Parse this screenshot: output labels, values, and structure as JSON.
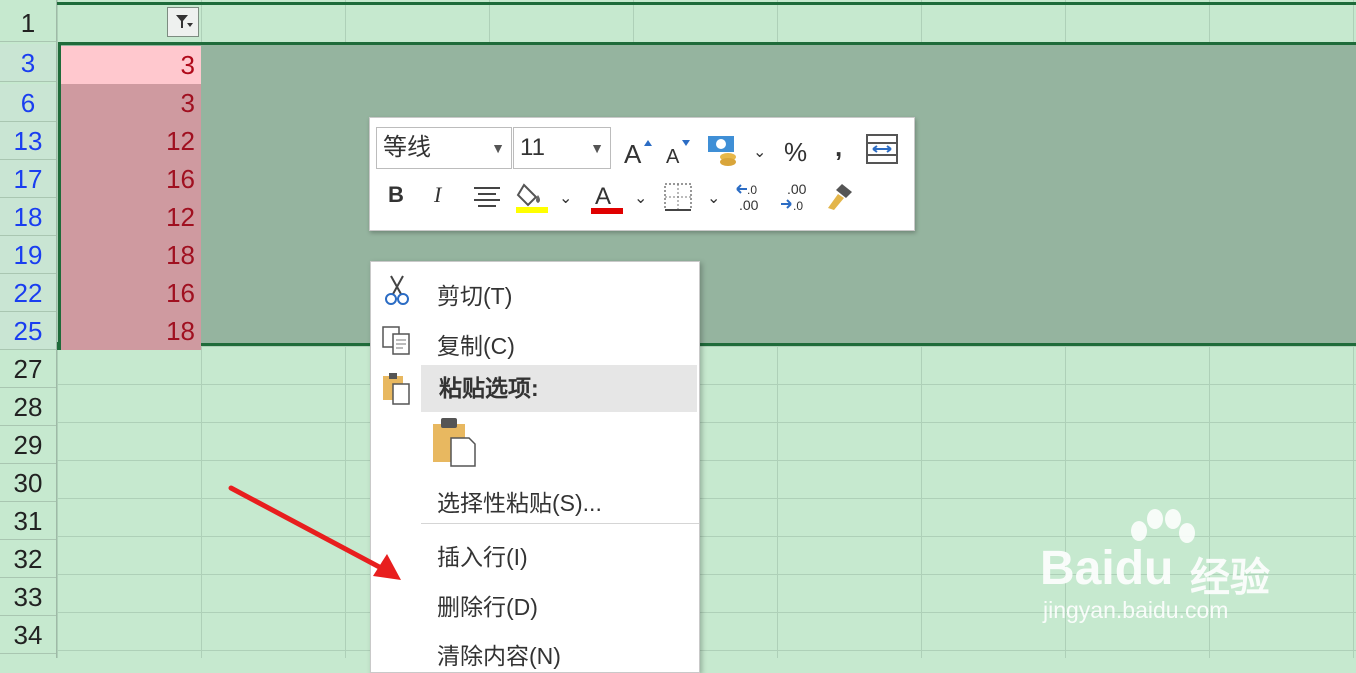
{
  "row_numbers": [
    "1",
    "3",
    "6",
    "13",
    "17",
    "18",
    "19",
    "22",
    "25",
    "27",
    "28",
    "29",
    "30",
    "31",
    "32",
    "33",
    "34"
  ],
  "selected_row_numbers": [
    "3",
    "6",
    "13",
    "17",
    "18",
    "19",
    "22",
    "25"
  ],
  "cell_values": [
    "3",
    "3",
    "12",
    "16",
    "12",
    "18",
    "16",
    "18"
  ],
  "filter_icon": "filter-dropdown-icon",
  "mini_toolbar": {
    "font_name": "等线",
    "font_size": "11",
    "percent_label": "%",
    "comma_label": ",",
    "bold_label": "B",
    "italic_label": "I",
    "font_color_label": "A",
    "increase_decimal_label": ".00",
    "decrease_decimal_label": ".00",
    "fill_color": "#ffff00",
    "font_color": "#e00000"
  },
  "context_menu": {
    "cut": "剪切(T)",
    "copy": "复制(C)",
    "paste_options": "粘贴选项:",
    "paste_special": "选择性粘贴(S)...",
    "insert_row": "插入行(I)",
    "delete_row": "删除行(D)",
    "clear_contents": "清除内容(N)"
  },
  "watermark": {
    "brand": "Baidu",
    "brand_cn": "经验",
    "url": "jingyan.baidu.com"
  },
  "colors": {
    "sheet_bg": "#c6e9cf",
    "selection_bg": "#95b49f",
    "selection_border": "#1f6b3a",
    "cell_highlight": "#cf9aa0",
    "cell_text": "#a01020",
    "row_selected_text": "#1a3ef0",
    "arrow": "#e81e1e"
  }
}
